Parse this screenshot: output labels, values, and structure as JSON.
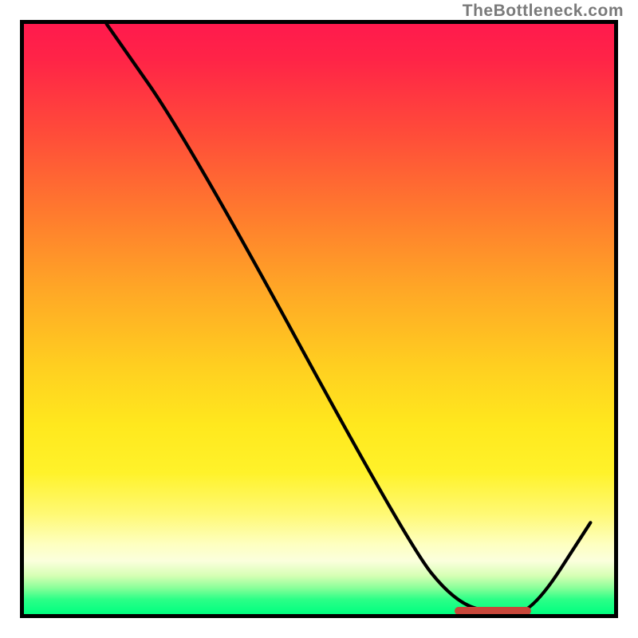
{
  "watermark": "TheBottleneck.com",
  "colors": {
    "frame": "#000000",
    "curve": "#000000",
    "category_band": "#c8473a",
    "gradient_top": "#ff1a4d",
    "gradient_bottom": "#00ff80"
  },
  "chart_data": {
    "type": "line",
    "title": "",
    "xlabel": "",
    "ylabel": "",
    "xlim": [
      0,
      100
    ],
    "ylim": [
      0,
      100
    ],
    "note": "Values in percent of plotting area. Curve starts at top-left, descends steeply to a minimum near x≈80, then rises.",
    "x": [
      14,
      28,
      65,
      73,
      80,
      86,
      96
    ],
    "y": [
      100,
      80,
      12,
      2,
      0,
      0,
      15.5
    ],
    "category_band": {
      "x_start": 73,
      "x_end": 86,
      "y": 0.6
    }
  }
}
